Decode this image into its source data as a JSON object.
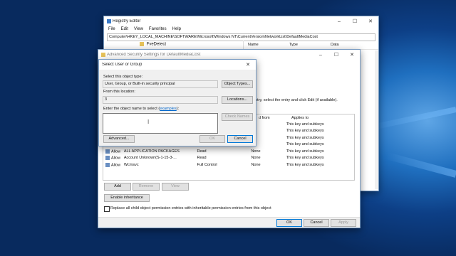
{
  "registry_editor": {
    "title": "Registry Editor",
    "menu": [
      "File",
      "Edit",
      "View",
      "Favorites",
      "Help"
    ],
    "address": "Computer\\HKEY_LOCAL_MACHINE\\SOFTWARE\\Microsoft\\Windows NT\\CurrentVersion\\NetworkList\\DefaultMediaCost",
    "tree_item": "FveDetect",
    "columns": [
      "Name",
      "Type",
      "Data"
    ]
  },
  "advanced_security": {
    "title": "Advanced Security Settings for DefaultMediaCost",
    "instruction": "entry, select the entry and click Edit (if available).",
    "col_inherited": "d from",
    "col_applies": "Applies to",
    "rows": [
      {
        "type": "",
        "principal": "",
        "access": "",
        "inherited": "",
        "applies": "This key and subkeys"
      },
      {
        "type": "",
        "principal": "",
        "access": "",
        "inherited": "",
        "applies": "This key and subkeys"
      },
      {
        "type": "",
        "principal": "",
        "access": "",
        "inherited": "",
        "applies": "This key and subkeys"
      },
      {
        "type": "",
        "principal": "",
        "access": "",
        "inherited": "",
        "applies": "This key and subkeys"
      },
      {
        "type": "Allow",
        "principal": "ALL APPLICATION PACKAGES",
        "access": "Read",
        "inherited": "None",
        "applies": "This key and subkeys"
      },
      {
        "type": "Allow",
        "principal": "Account Unknown(S-1-15-3-...",
        "access": "Read",
        "inherited": "None",
        "applies": "This key and subkeys"
      },
      {
        "type": "Allow",
        "principal": "Wcmsvc",
        "access": "Full Control",
        "inherited": "None",
        "applies": "This key and subkeys"
      }
    ],
    "add_label": "Add",
    "remove_label": "Remove",
    "view_label": "View",
    "enable_inheritance_label": "Enable inheritance",
    "replace_label": "Replace all child object permission entries with inheritable permission entries from this object",
    "ok_label": "OK",
    "cancel_label": "Cancel",
    "apply_label": "Apply"
  },
  "select_user": {
    "title": "Select User or Group",
    "object_type_label": "Select this object type:",
    "object_type_value": "User, Group, or Built-in security principal",
    "object_types_button": "Object Types...",
    "location_label": "From this location:",
    "location_value": "3",
    "locations_button": "Locations...",
    "enter_label": "Enter the object name to select",
    "examples_link": "examples",
    "enter_label_tail": "):",
    "check_names_button": "Check Names",
    "advanced_button": "Advanced...",
    "ok_button": "OK",
    "cancel_button": "Cancel"
  }
}
